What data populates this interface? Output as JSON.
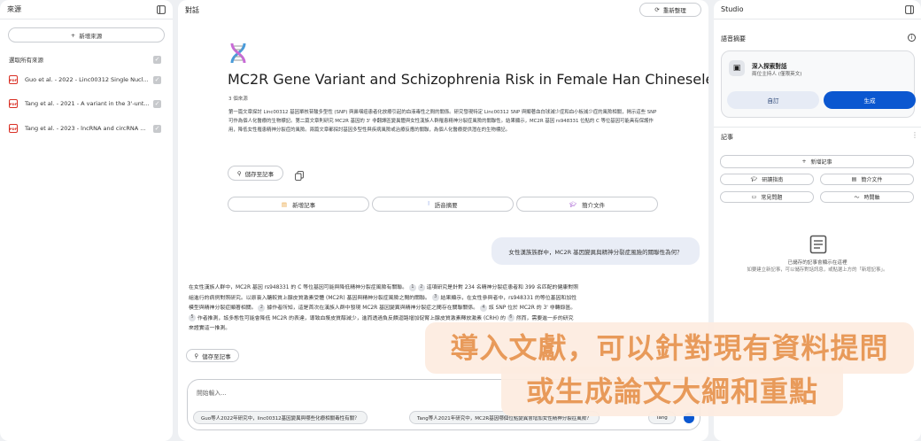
{
  "left": {
    "title": "來源",
    "add_source": "新增來源",
    "select_all": "選取所有來源",
    "sources": [
      {
        "label": "Guo et al. - 2022 - Linc00312 Single Nucl..."
      },
      {
        "label": "Tang et al. - 2021 - A variant in the 3'-unt..."
      },
      {
        "label": "Tang et al. - 2023 - lncRNA and circRNA ..."
      }
    ]
  },
  "mid": {
    "title": "對話",
    "refresh": "重新整理",
    "doc_title": "MC2R Gene Variant and Schizophrenia Risk in Female Han Chinesele",
    "source_count": "3 個來源",
    "summary": "第一篇文章探討 Linc00312 基因單核苷酸多型性 (SNP) 與鼻咽癌患者化放療引起的血液毒性之間的關係。研究發現特定 Linc00312 SNP 與顯著血白球減少症和血小板減少症的風險相關，揭示這些 SNP 可作為個人化醫療的生物標記。第二篇文章則研究 MC2R 基因的 3' 非翻譯區變異體與女性漢族人群罹患精神分裂症風險的關聯性。結果顯示，MC2R 基因 rs948331 位點的 C 等位基因可能具有保護作用，降低女性罹患精神分裂症的風險。兩篇文章都探討基因多型性與疾病風險或治療反應的關聯，為個人化醫療提供潛在的生物標記。",
    "save_note": "儲存至記事",
    "actions": [
      "新增記事",
      "語音摘要",
      "簡介文件"
    ],
    "question": "女性漢族族群中，MC2R 基因變異與精神分裂症風險的關聯性為何？",
    "answer": {
      "s1": "在女性漢族人群中，MC2R 基因 rs948331 的 C 等位基因可能與降低精神分裂症風險有關聯。",
      "n1": "1",
      "n2": "2",
      "s2": "這項研究是針對 234 名精神分裂症患者和 399 名匹配的健康對照組進行的病例對照研究。以原衰入醣較質上腺皮質激素受體 (MC2R) 基因與精神分裂症風險之間的關聯。",
      "n3": "3",
      "s3": "結果顯示，在女性參與者中，rs948331 的等位基因和加性模型與精神分裂症顯著相關。",
      "n4": "2",
      "s4": "據作者所知，這是首次在漢族人群中發現 MC2R 基因變異與精神分裂症之間存在關聯關係。",
      "n5": "4",
      "s5": "該 SNP 位於 MC2R 的 3' 非轉錄區。",
      "n6": "5",
      "s6": "作者推測，該多態性可能會降低 MC2R 的表達，導致血漿皮質醇減少，進而透過負反饋迴路增加促腎上腺皮質激素釋放激素 (CRH) 的",
      "n7": "6",
      "s7": "然而，需要進一步的研究來證實這一推測。"
    },
    "save_note2": "儲存至記事",
    "input_placeholder": "開始輸入...",
    "suggestions": [
      "Guo等人2022年研究中，linc00312基因變異與哪些化療相關毒性有關？",
      "Tang等人2021年研究中，MC2R基因哪個位點變異會增加女性精神分裂症風險？",
      "Tang"
    ]
  },
  "right": {
    "title": "Studio",
    "audio_title": "語音摘要",
    "card": {
      "title": "深入探索對話",
      "subtitle": "兩位主持人 (僅限英文)",
      "customize": "自訂",
      "generate": "生成"
    },
    "notes_title": "記事",
    "add_note": "新增記事",
    "note_buttons": [
      "研讀指南",
      "簡介文件",
      "常見問題",
      "時間軸"
    ],
    "empty_line1": "已儲存的記事會顯示在這裡",
    "empty_line2": "如要建立新記事，可以儲存對話訊息，或點選上方的「新增記事」。"
  },
  "overlay": {
    "line1": "導入文獻，可以針對現有資料提問",
    "line2": "或生成論文大綱和重點"
  },
  "colors": {
    "primary": "#0b57d0",
    "overlay_bg": "#fdece0",
    "overlay_text": "#e89a5a"
  }
}
